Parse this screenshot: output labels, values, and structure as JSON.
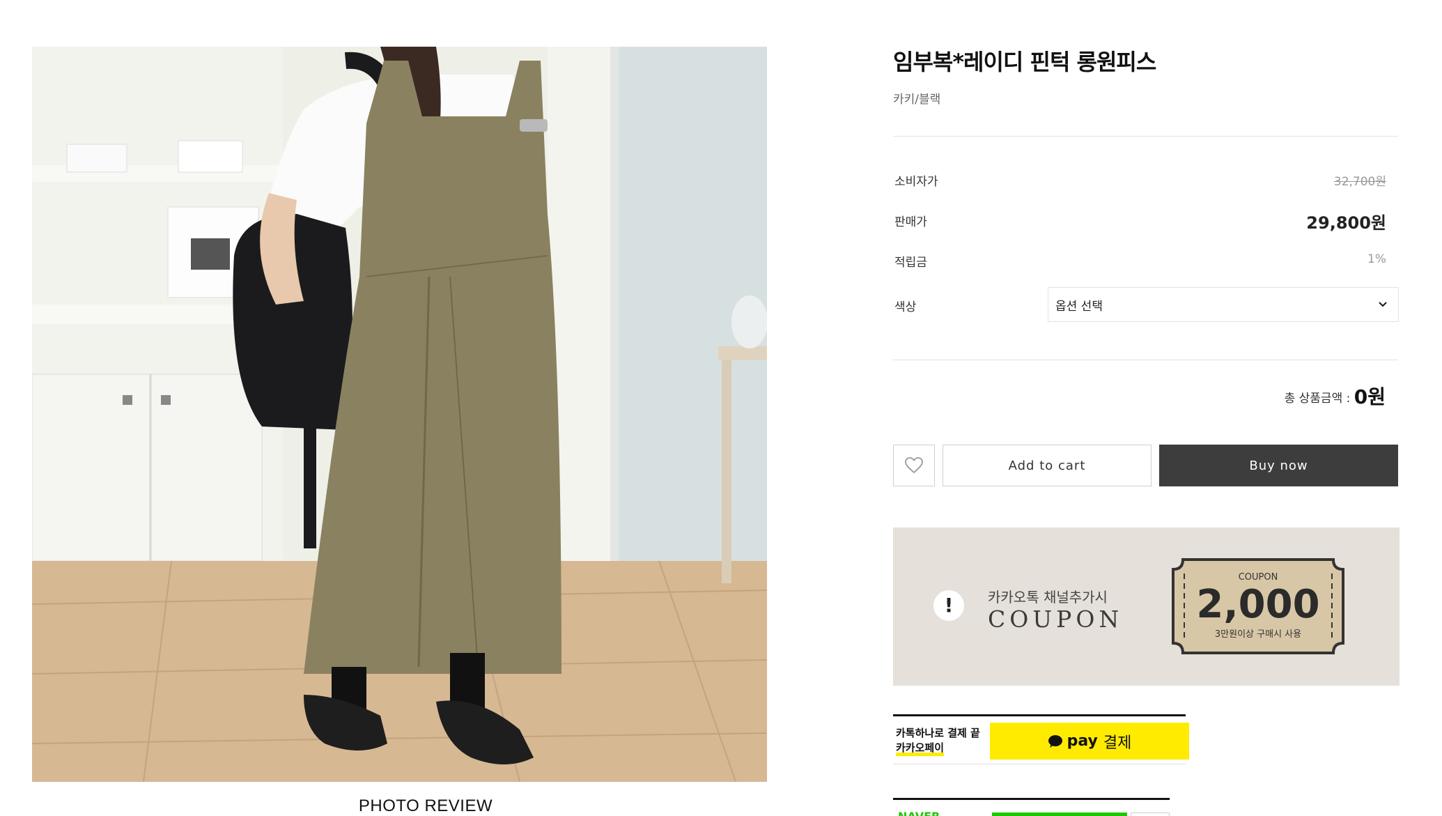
{
  "photo": {
    "alt": "",
    "footer_label": "PHOTO REVIEW"
  },
  "product": {
    "name": "임부복*레이디 핀턱 롱원피스",
    "color_summary": "카키/블랙"
  },
  "prices": {
    "retail_label": "소비자가",
    "retail_value": "32,700원",
    "sale_label": "판매가",
    "sale_value": "29,800원",
    "points_label": "적립금",
    "points_value": "1%"
  },
  "option": {
    "label": "색상",
    "selected": "옵션 선택"
  },
  "total": {
    "label": "총 상품금액 : ",
    "amount": "0원"
  },
  "actions": {
    "wishlist_icon": "heart-icon",
    "add_to_cart": "Add to cart",
    "buy_now": "Buy now"
  },
  "coupon_banner": {
    "kakao_text": "카카오톡 채널추가시",
    "word": "COUPON",
    "ticket_label": "COUPON",
    "ticket_value": "2,000",
    "ticket_condition": "3만원이상 구매시 사용",
    "bg_color": "#e5e0d9"
  },
  "kakaopay": {
    "caption_line1": "카톡하나로 결제 끝",
    "caption_line2": "카카오페이",
    "button_pay": "pay",
    "button_text": "결제",
    "color": "#ffeb00"
  },
  "naver": {
    "label": "NAVER",
    "color": "#1ec800"
  },
  "colors": {
    "buy_now_bg": "#3d3d3d",
    "dress": "#8a8160"
  }
}
